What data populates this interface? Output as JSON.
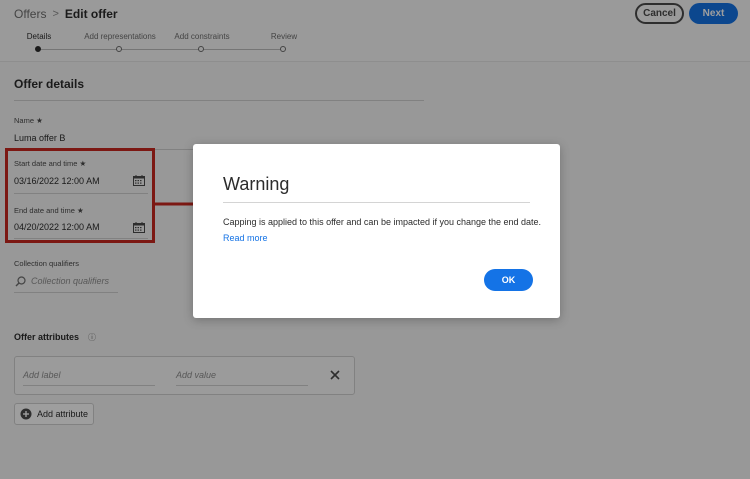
{
  "header": {
    "breadcrumb_parent": "Offers",
    "breadcrumb_separator": ">",
    "breadcrumb_current": "Edit offer",
    "cancel_label": "Cancel",
    "next_label": "Next"
  },
  "steps": [
    {
      "label": "Details",
      "active": true
    },
    {
      "label": "Add representations",
      "active": false
    },
    {
      "label": "Add constraints",
      "active": false
    },
    {
      "label": "Review",
      "active": false
    }
  ],
  "form": {
    "section_title": "Offer details",
    "name_label": "Name ★",
    "name_value": "Luma offer B",
    "start_label": "Start date and time ★",
    "start_value": "03/16/2022 12:00 AM",
    "end_label": "End date and time ★",
    "end_value": "04/20/2022 12:00 AM",
    "qualifiers_label": "Collection qualifiers",
    "qualifiers_placeholder": "Collection qualifiers"
  },
  "attributes": {
    "title": "Offer attributes",
    "info_icon": "ⓘ",
    "label_placeholder": "Add label",
    "value_placeholder": "Add value",
    "add_button_label": "Add attribute"
  },
  "dialog": {
    "title": "Warning",
    "message": "Capping is applied to this offer and can be impacted if you change the end date.",
    "link_label": "Read more",
    "ok_label": "OK"
  },
  "colors": {
    "accent": "#1473e6",
    "highlight_red": "#c8271f",
    "text": "#2c2c2c"
  },
  "icons": {
    "calendar": "calendar-icon",
    "search": "search-icon",
    "close": "close-icon",
    "add": "plus-circle-icon",
    "info": "info-icon"
  }
}
